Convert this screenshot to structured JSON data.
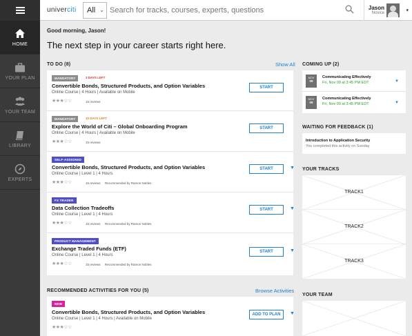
{
  "header": {
    "logo_prefix": "univer",
    "logo_suffix": "citi",
    "filter_value": "All",
    "search_placeholder": "Search for tracks, courses, experts, questions",
    "user_name": "Jason",
    "user_role": "Novice"
  },
  "sidebar": {
    "items": [
      {
        "label": "HOME",
        "icon": "home-icon"
      },
      {
        "label": "YOUR PLAN",
        "icon": "briefcase-icon"
      },
      {
        "label": "YOUR TEAM",
        "icon": "team-icon"
      },
      {
        "label": "LIBRARY",
        "icon": "book-icon"
      },
      {
        "label": "EXPERTS",
        "icon": "compass-icon"
      }
    ]
  },
  "main": {
    "greeting": "Good morning, Jason!",
    "headline": "The next step in your career starts right here.",
    "todo": {
      "title": "TO DO (8)",
      "link": "Show All",
      "items": [
        {
          "badge": "MANDATORY",
          "badge_color": "#8c8c8c",
          "due": "3 DAYS LEFT",
          "due_color": "#e0312b",
          "title": "Convertible Bonds, Structured Products, and Option Variables",
          "meta": "Online Course  |  4 Hours  |  Available on Mobile",
          "rating_stars": "★★★☆☆",
          "reviews": "15 reviews",
          "recommended": "",
          "button": "START",
          "has_caret": false
        },
        {
          "badge": "MANDATORY",
          "badge_color": "#8c8c8c",
          "due": "10 DAYS LEFT",
          "due_color": "#e07b1a",
          "title": "Explore the World of Citi – Global Onboarding Program",
          "meta": "Online Course  |  4 Hours  |  Available on Mobile",
          "rating_stars": "★★★☆☆",
          "reviews": "15 reviews",
          "recommended": "",
          "button": "START",
          "has_caret": false
        },
        {
          "badge": "SELF-ASSIGNED",
          "badge_color": "#4f4fc4",
          "due": "",
          "due_color": "",
          "title": "Convertible Bonds, Structured Products, and Option Variables",
          "meta": "Online Course  |  Level 1  |  4 Hours",
          "rating_stars": "★★★☆☆",
          "reviews": "15 reviews",
          "recommended": "Recommended by Ramon Nobles",
          "button": "START",
          "has_caret": true
        },
        {
          "badge": "FX TRADER",
          "badge_color": "#4f4fc4",
          "due": "",
          "due_color": "",
          "title": "Data Collection Tradeoffs",
          "meta": "Online Course  |  Level 1  |  4 Hours",
          "rating_stars": "★★★☆☆",
          "reviews": "15 reviews",
          "recommended": "Recommended by Ramon Nobles",
          "button": "START",
          "has_caret": true
        },
        {
          "badge": "PRODUCT MANAGEMENT",
          "badge_color": "#4f4fc4",
          "due": "",
          "due_color": "",
          "title": "Exchange Traded Funds (ETF)",
          "meta": "Online Course  |  Level 1  |  4 Hours",
          "rating_stars": "★★★☆☆",
          "reviews": "15 reviews",
          "recommended": "Recommended by Ramon Nobles",
          "button": "START",
          "has_caret": true
        }
      ]
    },
    "recommended": {
      "title": "RECOMMENDED ACTIVITIES FOR YOU (5)",
      "link": "Browse Activities",
      "items": [
        {
          "badge": "NEW",
          "badge_color": "#d6249f",
          "title": "Convertible Bonds, Structured Products, and Option Variables",
          "meta": "Online Course  |  Level 1  |  4 Hours  |  Available on Mobile",
          "rating_stars": "★★★☆☆",
          "button": "ADD TO PLAN"
        }
      ]
    }
  },
  "right": {
    "coming_up": {
      "title": "COMING UP (2)",
      "items": [
        {
          "month": "NOV",
          "day": "09",
          "title": "Communicating Effectively",
          "date": "Fri, Nov 09 at 3:45 PM EDT"
        },
        {
          "month": "NOV",
          "day": "09",
          "title": "Communicating Effectively",
          "date": "Fri, Nov 09 at 3:45 PM EDT"
        }
      ]
    },
    "feedback": {
      "title": "WAITING FOR FEEDBACK (1)",
      "item_title": "Introduction to Application Security",
      "item_sub": "You completed this activity on Sunday"
    },
    "tracks": {
      "title": "YOUR TRACKS",
      "items": [
        "TRACK1",
        "TRACK2",
        "TRACK3"
      ]
    },
    "team": {
      "title": "YOUR TEAM"
    }
  }
}
